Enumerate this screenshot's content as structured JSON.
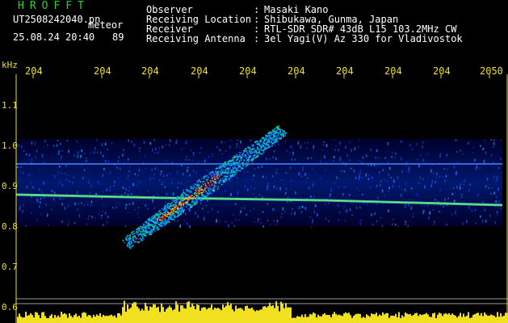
{
  "header": {
    "logo": "HROFFT",
    "filename": "UT2508242040.pn",
    "meteor_label": "meteor",
    "datetime": "25.08.24 20:40",
    "count": "89"
  },
  "meta": [
    {
      "label": "Observer",
      "value": "Masaki Kano"
    },
    {
      "label": "Receiving Location",
      "value": "Shibukawa, Gunma, Japan"
    },
    {
      "label": "Receiver",
      "value": "RTL-SDR SDR# 43dB L15 103.2MHz CW"
    },
    {
      "label": "Receiving Antenna",
      "value": "3el Yagi(V) Az 330 for Vladivostok"
    }
  ],
  "axis": {
    "unit": "kHz",
    "x_ticks": [
      "204",
      "204",
      "204",
      "204",
      "204",
      "204",
      "204",
      "204",
      "204",
      "2050"
    ],
    "y_ticks": [
      "1.1",
      "1.0",
      "0.9",
      "0.8",
      "0.7",
      "0.6"
    ]
  },
  "colors": {
    "background": "#000000",
    "label": "#f0e020",
    "text": "#ffffff",
    "logo": "#2fd02f"
  }
}
